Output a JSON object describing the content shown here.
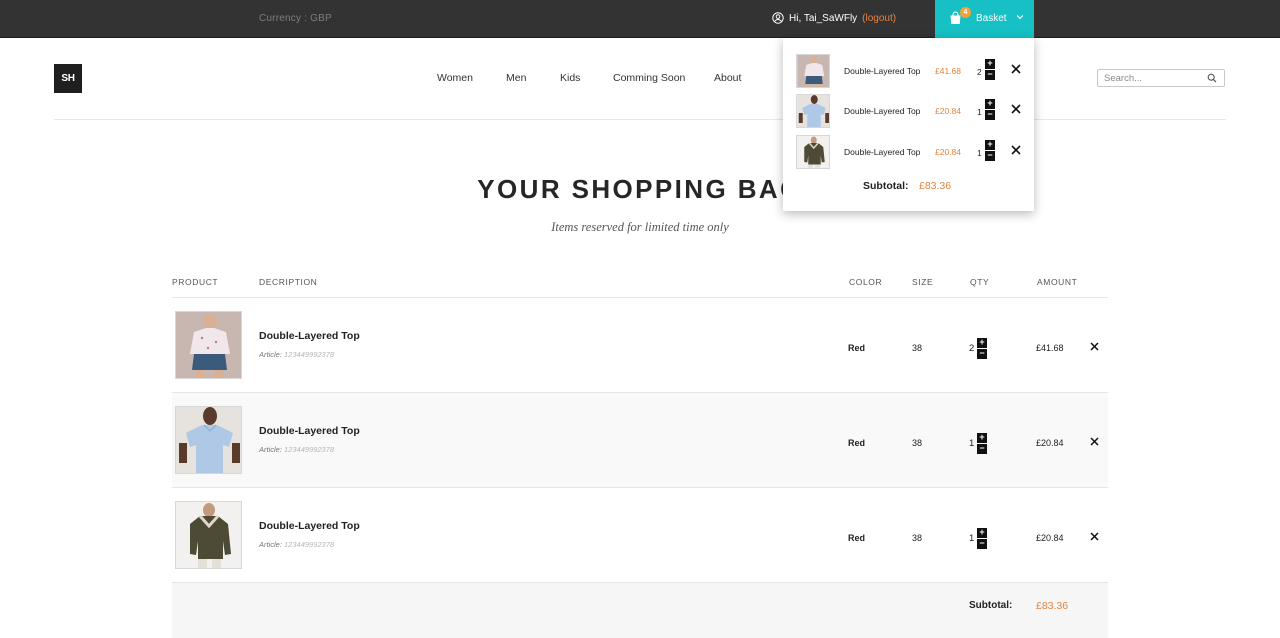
{
  "topbar": {
    "currency": "Currency : GBP",
    "greeting": "Hi, Tai_SaWFly",
    "paren_open": "(",
    "logout": "logout",
    "paren_close": ")",
    "basket_label": "Basket",
    "basket_count": "4"
  },
  "header": {
    "logo": "SH",
    "nav": [
      "Women",
      "Men",
      "Kids",
      "Comming Soon",
      "About"
    ],
    "search_placeholder": "Search..."
  },
  "page": {
    "title": "YOUR SHOPPING BAG",
    "subtitle": "Items reserved for limited time only"
  },
  "table": {
    "headers": {
      "product": "PRODUCT",
      "description": "DECRIPTION",
      "color": "COLOR",
      "size": "SIZE",
      "qty": "QTY",
      "amount": "AMOUNT"
    },
    "rows": [
      {
        "name": "Double-Layered Top",
        "article_label": "Article:",
        "article": "123449992378",
        "color": "Red",
        "size": "38",
        "qty": "2",
        "amount": "£41.68",
        "image": "pink-top-denim-shorts"
      },
      {
        "name": "Double-Layered Top",
        "article_label": "Article:",
        "article": "123449992378",
        "color": "Red",
        "size": "38",
        "qty": "1",
        "amount": "£20.84",
        "image": "blue-shirt"
      },
      {
        "name": "Double-Layered Top",
        "article_label": "Article:",
        "article": "123449992378",
        "color": "Red",
        "size": "38",
        "qty": "1",
        "amount": "£20.84",
        "image": "olive-jacket"
      }
    ],
    "subtotal_label": "Subtotal:",
    "subtotal": "£83.36"
  },
  "minicart": {
    "items": [
      {
        "name": "Double-Layered Top",
        "price": "£41.68",
        "qty": "2"
      },
      {
        "name": "Double-Layered Top",
        "price": "£20.84",
        "qty": "1"
      },
      {
        "name": "Double-Layered Top",
        "price": "£20.84",
        "qty": "1"
      }
    ],
    "subtotal_label": "Subtotal:",
    "subtotal": "£83.36"
  },
  "icons": {
    "user": "user-circle-icon",
    "bag": "shopping-bag-icon",
    "chevron": "chevron-down-icon",
    "search": "search-icon",
    "remove": "close-icon",
    "plus": "plus-icon",
    "minus": "minus-icon"
  },
  "colors": {
    "topbar": "#333333",
    "accent": "#16c0c4",
    "price": "#e4833f",
    "badge": "#f0a63a"
  },
  "stepper": {
    "plus": "+",
    "minus": "−"
  }
}
